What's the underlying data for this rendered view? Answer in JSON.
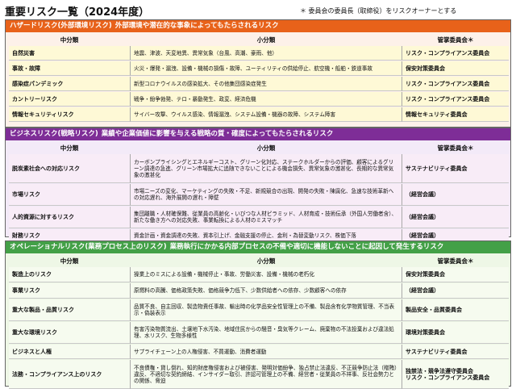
{
  "title": "重要リスク一覧（2024年度）",
  "note": "＊ 委員会の委員長（取締役）をリスクオーナーとする",
  "columns": {
    "mid": "中分類",
    "small": "小分類",
    "committee": "管掌委員会＊"
  },
  "colors": {
    "hazard": "#e8621a",
    "business": "#7e2d97",
    "operational": "#43a047"
  },
  "hazard": {
    "label": "ハザードリスク(外部環境リスク)",
    "desc": "外部環境や潜在的な事象によってもたらされるリスク",
    "rows": [
      {
        "mid": "自然災害",
        "small": "地震、津波、天変地異、異常気象（台風、高潮、豪雨、他）",
        "committee": "リスク・コンプライアンス委員会"
      },
      {
        "mid": "事故・故障",
        "small": "火災・爆発・漏洩、設備・機械の損傷・故障、ユーティリティの供給停止、航空機・船舶・鉄道事故",
        "committee": "保安対策委員会"
      },
      {
        "mid": "感染症パンデミック",
        "small": "新型コロナウイルスの感染拡大、その他集団感染症発生",
        "committee": "リスク・コンプライアンス委員会"
      },
      {
        "mid": "カントリーリスク",
        "small": "戦争・紛争勃発、テロ・暴動発生、政変、経済危機",
        "committee": "リスク・コンプライアンス委員会"
      },
      {
        "mid": "情報セキュリティリスク",
        "small": "サイバー攻撃、ウイルス感染、情報漏洩、システム設備・機器の故障、システム障害",
        "committee": "情報セキュリティ委員会"
      }
    ]
  },
  "business": {
    "label": "ビジネスリスク(戦略リスク)",
    "desc": "業績や企業価値に影響を与える戦略の質・確度によってもたらされるリスク",
    "rows": [
      {
        "mid": "脱炭素社会への対応リスク",
        "small": "カーボンプライシングとエネルギーコスト、グリーン化対応、ステークホルダーからの評価、顧客によるグリーン調達の急進、グリーン市場拡大に追随できないことによる機会損失、異常気象の激甚化、長期的な異常気象の激甚化",
        "committee": "サステナビリティ委員会"
      },
      {
        "mid": "市場リスク",
        "small": "市場ニーズの変化、マーケティングの失敗・不足、新規競合の出現、開発の失敗・陳腐化、急速な技術革新への対応遅れ、海外展開の遅れ・障壁",
        "committee": "（経営会議）"
      },
      {
        "mid": "人的資源に対するリスク",
        "small": "集団離職・人材確保難、従業員の高齢化・いびつな人材ピラミッド、人材育成・技術伝承（外国人労働者含）、新たな働き方への対応失敗、事業転換による人材のミスマッチ",
        "committee": "（経営会議）"
      },
      {
        "mid": "財務リスク",
        "small": "資金計画・資金調達の失敗、資本引上げ、金融支援の停止、金利・為替変動リスク、株価下落",
        "committee": "（経営会議）"
      }
    ]
  },
  "operational": {
    "label": "オペレーショナルリスク(業務プロセス上のリスク)",
    "desc": "業務執行にかかる内部プロセスの不備や適切に機能しないことに起因して発生するリスク",
    "rows": [
      {
        "mid": "製造上のリスク",
        "small": "操業上のミスによる設備・機械停止・事故、労働災害、設備・機械の老朽化",
        "committee": "保安対策委員会"
      },
      {
        "mid": "事業リスク",
        "small": "原燃料の高騰、価格政策失敗、価格競争力低下、少数供給者への依存、少数顧客への依存",
        "committee": "（経営会議）"
      },
      {
        "mid": "重大な製品・品質リスク",
        "small": "品質不良、自主回収、製造物責任事故、輸出時の化学品安全性管理上の不備、製品含有化学物質管理、不当表示・偽装表示",
        "committee": "製品安全・品質委員会"
      },
      {
        "mid": "重大な環境リスク",
        "small": "有害汚染物質流出、土壌地下水汚染、地域住民からの騒音・臭気等クレーム、廃棄物の不法投棄および違法処理、水リスク、生物多様性",
        "committee": "環境対策委員会"
      },
      {
        "mid": "ビジネスと人権",
        "small": "サプライチェーン上の人権侵害、不買運動、消費者運動",
        "committee": "サステナビリティ委員会"
      },
      {
        "mid": "法務・コンプライアンス上のリスク",
        "small": "不良債権・貸し倒れ、知的財産権侵害および被侵害、発明対価紛争、独占禁止法違反、不正競争防止法（贈賄）違反、不適切な契約締結、インサイダー取引、許認可管理上の不備、経営者・従業員の不祥事、反社会勢力との関係、脅迫",
        "committee": "独禁法・競争法遵守委員会\nリスク・コンプライアンス委員会"
      }
    ]
  }
}
